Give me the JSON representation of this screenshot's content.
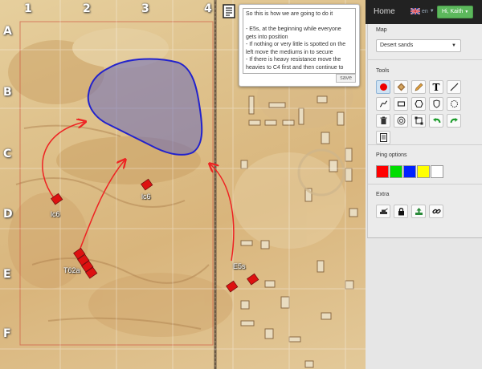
{
  "app": {
    "home_label": "Home",
    "language_code": "en",
    "user_label": "Hi, Kaith"
  },
  "map": {
    "section_label": "Map",
    "selected_map": "Desert sands",
    "grid_columns": [
      "1",
      "2",
      "3",
      "4"
    ],
    "grid_rows": [
      "A",
      "B",
      "C",
      "D",
      "E",
      "F"
    ]
  },
  "units": {
    "left_group_label": "lc6",
    "middle_group_label": "lc6",
    "south_group_label": "T62a",
    "east_group_label": "E5s"
  },
  "note": {
    "lines": [
      "So this is how we are going to do it",
      "",
      "- E5s, at the beginning while everyone",
      "gets into position",
      "- If nothing or very little is spotted on the",
      "left move the mediums in to secure",
      "- If there is heavy resistance move the",
      "heavies to C4 first and then continue to"
    ],
    "save_label": "save"
  },
  "tools": {
    "section_label": "Tools",
    "items": [
      {
        "icon": "ping-dot-icon",
        "active": true
      },
      {
        "icon": "tank-stamp-icon",
        "active": false
      },
      {
        "icon": "pencil-icon",
        "active": false
      },
      {
        "icon": "text-icon",
        "active": false,
        "glyph": "T"
      },
      {
        "icon": "line-icon",
        "active": false
      },
      {
        "icon": "curve-icon",
        "active": false
      },
      {
        "icon": "rectangle-icon",
        "active": false
      },
      {
        "icon": "hexagon-icon",
        "active": false
      },
      {
        "icon": "shield-icon",
        "active": false
      },
      {
        "icon": "circle-dashed-icon",
        "active": false
      },
      {
        "icon": "trash-icon",
        "active": false
      },
      {
        "icon": "target-icon",
        "active": false
      },
      {
        "icon": "select-box-icon",
        "active": false
      },
      {
        "icon": "undo-icon",
        "active": false
      },
      {
        "icon": "redo-icon",
        "active": false
      },
      {
        "icon": "notes-icon",
        "active": false
      }
    ]
  },
  "ping_options": {
    "section_label": "Ping options",
    "colors": [
      "#ff0000",
      "#00dd00",
      "#0022ff",
      "#ffff00",
      "#ffffff"
    ]
  },
  "extra": {
    "section_label": "Extra",
    "items": [
      {
        "icon": "tanks-icon"
      },
      {
        "icon": "lock-icon"
      },
      {
        "icon": "upload-icon"
      },
      {
        "icon": "link-icon"
      }
    ]
  },
  "colors": {
    "route_arrow": "#ee2222",
    "blue_zone_stroke": "#2222cc",
    "blue_zone_fill": "#6a6ab8",
    "user_button": "#5cb85c",
    "top_bar": "#222222"
  }
}
